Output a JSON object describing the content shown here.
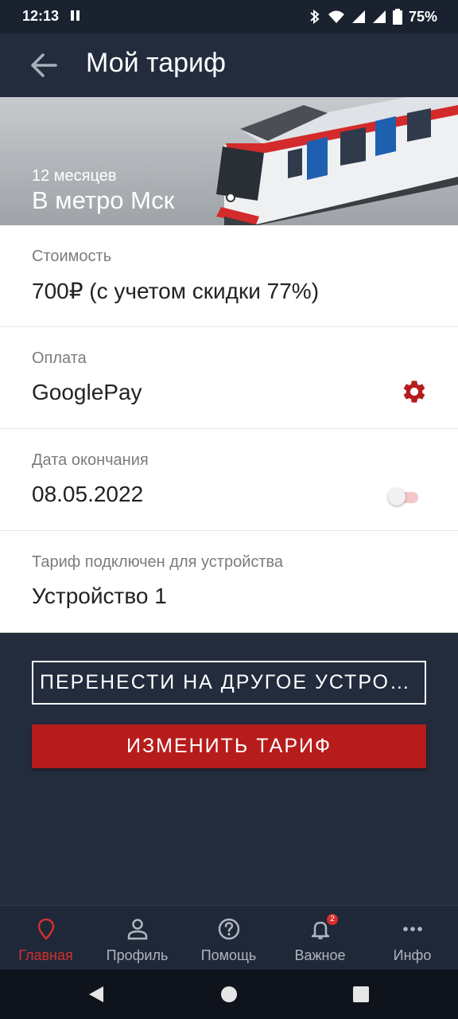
{
  "status_bar": {
    "time": "12:13",
    "battery": "75%"
  },
  "app_bar": {
    "title": "Мой тариф",
    "back_icon": "arrow-left-icon"
  },
  "hero": {
    "subtitle": "12 месяцев",
    "title": "В метро Мск"
  },
  "details": {
    "cost": {
      "label": "Стоимость",
      "value": "700₽ (с учетом скидки 77%)"
    },
    "payment": {
      "label": "Оплата",
      "value": "GooglePay",
      "icon": "gear-icon"
    },
    "end_date": {
      "label": "Дата окончания",
      "value": "08.05.2022",
      "toggle_on": false
    },
    "device": {
      "label": "Тариф подключен для устройства",
      "value": "Устройство 1"
    }
  },
  "buttons": {
    "transfer": "ПЕРЕНЕСТИ НА ДРУГОЕ УСТРОЙСТВО",
    "change": "ИЗМЕНИТЬ ТАРИФ"
  },
  "bottom_nav": {
    "items": [
      {
        "label": "Главная",
        "icon": "location-pin-icon",
        "active": true
      },
      {
        "label": "Профиль",
        "icon": "person-icon",
        "active": false
      },
      {
        "label": "Помощь",
        "icon": "help-circle-icon",
        "active": false
      },
      {
        "label": "Важное",
        "icon": "bell-icon",
        "active": false,
        "badge": "2"
      },
      {
        "label": "Инфо",
        "icon": "more-horizontal-icon",
        "active": false
      }
    ]
  },
  "colors": {
    "accent": "#b71c1c",
    "background": "#232c3d",
    "active_tab": "#d32f2f"
  }
}
